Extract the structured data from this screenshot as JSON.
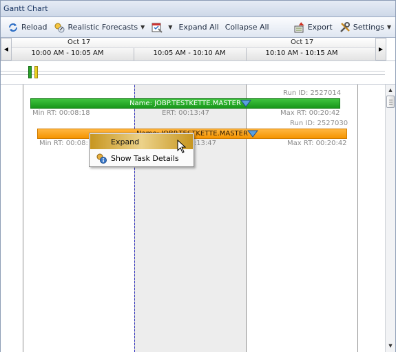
{
  "window": {
    "title": "Gantt Chart"
  },
  "toolbar": {
    "reload_label": "Reload",
    "forecast_label": "Realistic Forecasts",
    "expand_all_label": "Expand All",
    "collapse_all_label": "Collapse All",
    "export_label": "Export",
    "settings_label": "Settings"
  },
  "timeline": {
    "dates": [
      "Oct 17",
      "Oct 17"
    ],
    "intervals": [
      "10:00 AM - 10:05 AM",
      "10:05 AM - 10:10 AM",
      "10:10 AM - 10:15 AM"
    ]
  },
  "tasks": [
    {
      "name_label": "Name: JOBP.TESTKETTE.MASTER",
      "run_id": "Run ID: 2527014",
      "min_rt": "Min RT: 00:08:18",
      "ert": "ERT: 00:13:47",
      "max_rt": "Max RT: 00:20:42",
      "color": "#22a322"
    },
    {
      "name_label": "Name: JOBP.TESTKETTE.MASTER",
      "run_id": "Run ID: 2527030",
      "min_rt": "Min RT: 00:08:18",
      "ert": "ERT: 00:13:47",
      "max_rt": "Max RT: 00:20:42",
      "color": "#f7a21a"
    }
  ],
  "context_menu": {
    "items": [
      {
        "label": "Expand",
        "icon": "expand-icon",
        "highlighted": true
      },
      {
        "label": "Show Task Details",
        "icon": "task-details-icon",
        "highlighted": false
      }
    ]
  }
}
